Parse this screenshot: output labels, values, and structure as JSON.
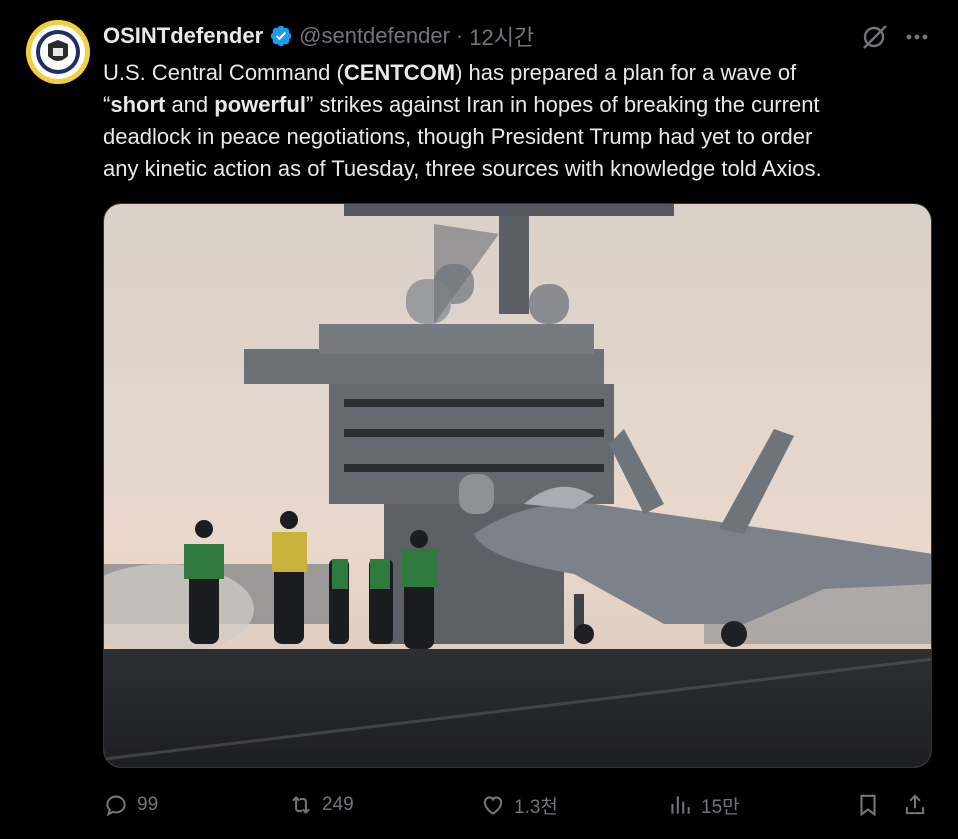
{
  "author": {
    "display_name": "OSINTdefender",
    "handle": "@sentdefender",
    "separator": "·",
    "time": "12시간",
    "verified_color": "#1d9bf0"
  },
  "tweet": {
    "segments": [
      {
        "text": "U.S. Central Command (",
        "bold": false
      },
      {
        "text": "CENTCOM",
        "bold": true
      },
      {
        "text": ") has prepared a plan for a wave of\n“",
        "bold": false
      },
      {
        "text": "short",
        "bold": true
      },
      {
        "text": " and ",
        "bold": false
      },
      {
        "text": "powerful",
        "bold": true
      },
      {
        "text": "” strikes against Iran in hopes of breaking the current\ndeadlock in peace negotiations, though President Trump had yet to order\nany kinetic action as of Tuesday, three sources with knowledge told Axios.",
        "bold": false
      }
    ]
  },
  "media": {
    "description_icon": "photo-aircraft-carrier"
  },
  "actions": {
    "reply_count": "99",
    "retweet_count": "249",
    "like_count": "1.3천",
    "views_count": "15만"
  },
  "colors": {
    "background": "#000000",
    "text": "#e7e9ea",
    "muted": "#71767b",
    "border": "#2f3336"
  }
}
